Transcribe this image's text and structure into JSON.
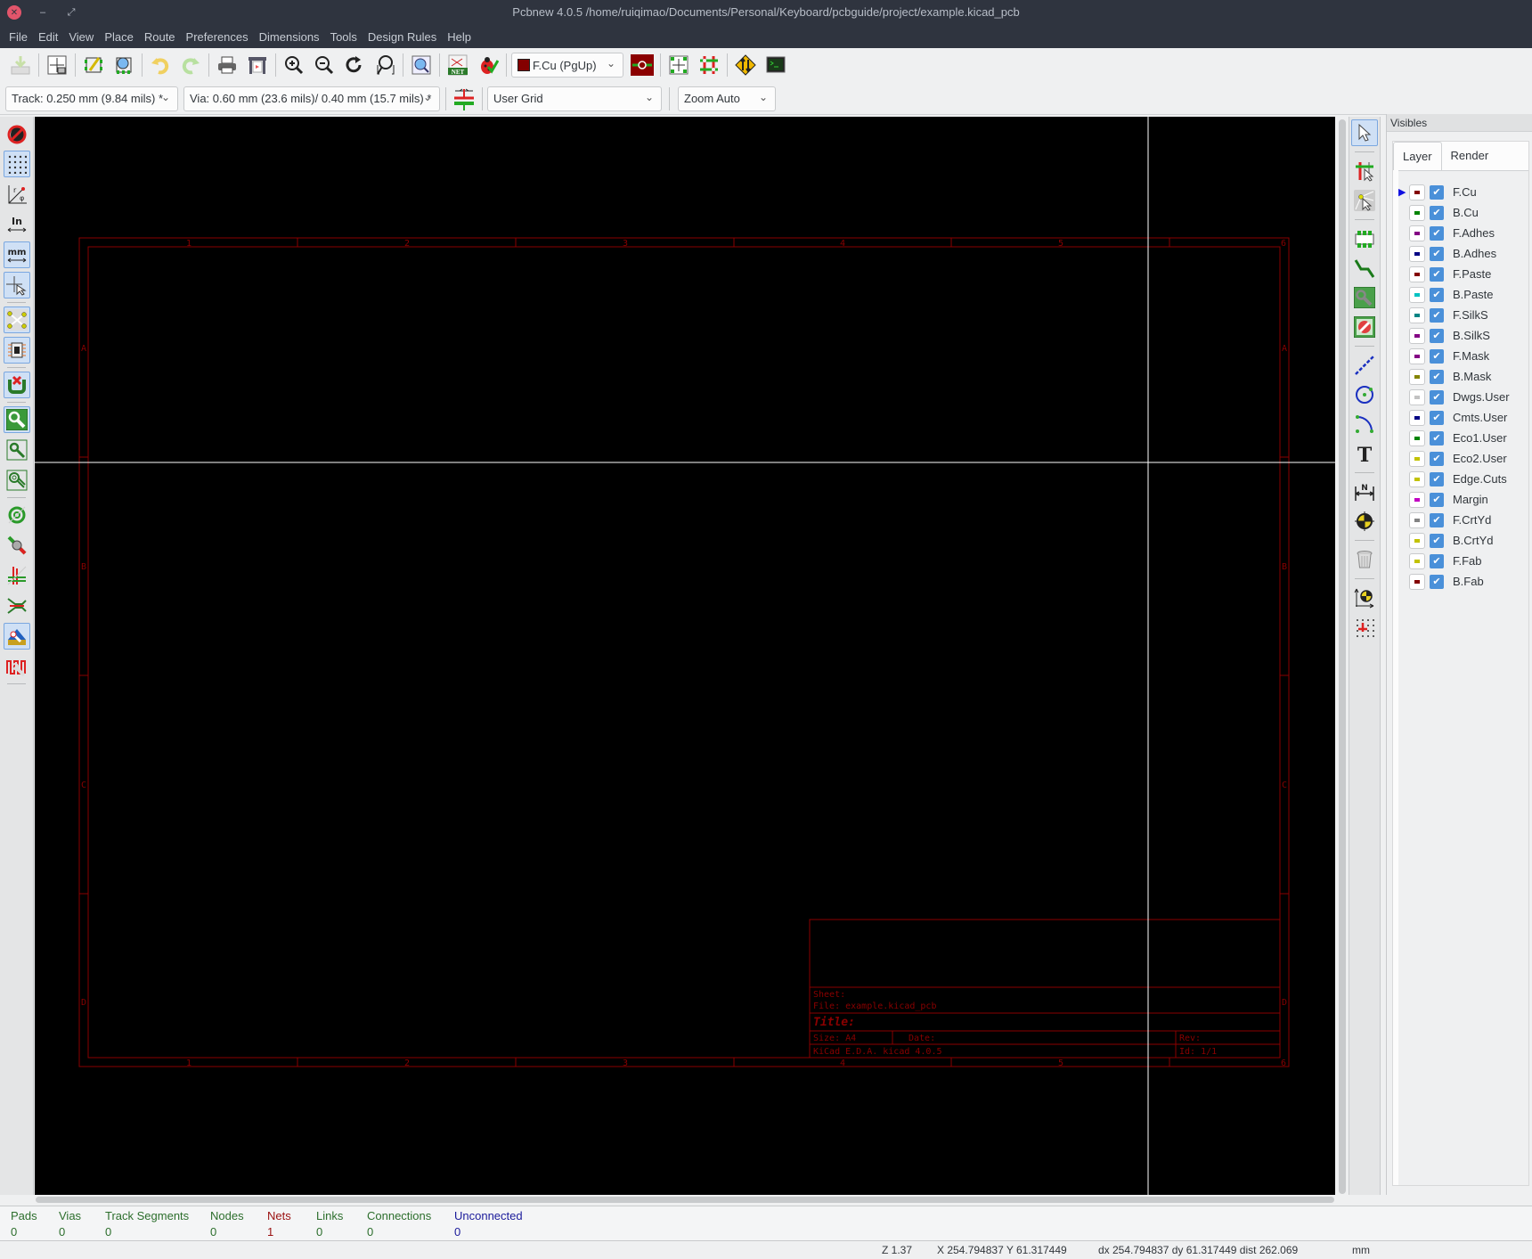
{
  "window": {
    "title": "Pcbnew 4.0.5 /home/ruiqimao/Documents/Personal/Keyboard/pcbguide/project/example.kicad_pcb",
    "close_icon": "✕",
    "minimize_icon": "–",
    "maximize_icon": "⤢"
  },
  "menu": [
    "File",
    "Edit",
    "View",
    "Place",
    "Route",
    "Preferences",
    "Dimensions",
    "Tools",
    "Design Rules",
    "Help"
  ],
  "toolbar": {
    "layer_select": "F.Cu (PgUp)",
    "layer_color": "#8b0000",
    "track_width": "Track: 0.250 mm (9.84 mils) *",
    "via_size": "Via: 0.60 mm (23.6 mils)/ 0.40 mm (15.7 mils) *",
    "grid": "User Grid",
    "zoom": "Zoom Auto"
  },
  "visibles": {
    "title": "Visibles",
    "tabs": [
      "Layer",
      "Render"
    ],
    "active_tab": "Layer",
    "layers": [
      {
        "name": "F.Cu",
        "color": "#840000",
        "checked": true,
        "active": true
      },
      {
        "name": "B.Cu",
        "color": "#008400",
        "checked": true
      },
      {
        "name": "F.Adhes",
        "color": "#840084",
        "checked": true
      },
      {
        "name": "B.Adhes",
        "color": "#000084",
        "checked": true
      },
      {
        "name": "F.Paste",
        "color": "#840000",
        "checked": true
      },
      {
        "name": "B.Paste",
        "color": "#00c2c2",
        "checked": true
      },
      {
        "name": "F.SilkS",
        "color": "#008484",
        "checked": true
      },
      {
        "name": "B.SilkS",
        "color": "#840084",
        "checked": true
      },
      {
        "name": "F.Mask",
        "color": "#840084",
        "checked": true
      },
      {
        "name": "B.Mask",
        "color": "#848400",
        "checked": true
      },
      {
        "name": "Dwgs.User",
        "color": "#c2c2c2",
        "checked": true
      },
      {
        "name": "Cmts.User",
        "color": "#000084",
        "checked": true
      },
      {
        "name": "Eco1.User",
        "color": "#008400",
        "checked": true
      },
      {
        "name": "Eco2.User",
        "color": "#c2c200",
        "checked": true
      },
      {
        "name": "Edge.Cuts",
        "color": "#c2c200",
        "checked": true
      },
      {
        "name": "Margin",
        "color": "#c200c2",
        "checked": true
      },
      {
        "name": "F.CrtYd",
        "color": "#848484",
        "checked": true
      },
      {
        "name": "B.CrtYd",
        "color": "#c2c200",
        "checked": true
      },
      {
        "name": "F.Fab",
        "color": "#c2c200",
        "checked": true
      },
      {
        "name": "B.Fab",
        "color": "#840000",
        "checked": true
      }
    ]
  },
  "sheet": {
    "col_labels": [
      "1",
      "2",
      "3",
      "4",
      "5",
      "6"
    ],
    "row_labels": [
      "A",
      "B",
      "C",
      "D"
    ],
    "sheet_label": "Sheet:",
    "file_label": "File: example.kicad_pcb",
    "title_label": "Title:",
    "size_label": "Size: A4",
    "date_label": "Date:",
    "rev_label": "Rev:",
    "kicad_label": "KiCad E.D.A.  kicad 4.0.5",
    "id_label": "Id: 1/1"
  },
  "stats": [
    {
      "label": "Pads",
      "value": "0",
      "color": "#2c6e2c"
    },
    {
      "label": "Vias",
      "value": "0",
      "color": "#2c6e2c"
    },
    {
      "label": "Track Segments",
      "value": "0",
      "color": "#2c6e2c"
    },
    {
      "label": "Nodes",
      "value": "0",
      "color": "#2c6e2c"
    },
    {
      "label": "Nets",
      "value": "1",
      "color": "#9a1010"
    },
    {
      "label": "Links",
      "value": "0",
      "color": "#2c6e2c"
    },
    {
      "label": "Connections",
      "value": "0",
      "color": "#2c6e2c"
    },
    {
      "label": "Unconnected",
      "value": "0",
      "color": "#1a1a9a"
    }
  ],
  "statusbar": {
    "zoom": "Z 1.37",
    "abs_coords": "X 254.794837  Y 61.317449",
    "rel_coords": "dx 254.794837  dy 61.317449  dist 262.069",
    "units": "mm"
  }
}
